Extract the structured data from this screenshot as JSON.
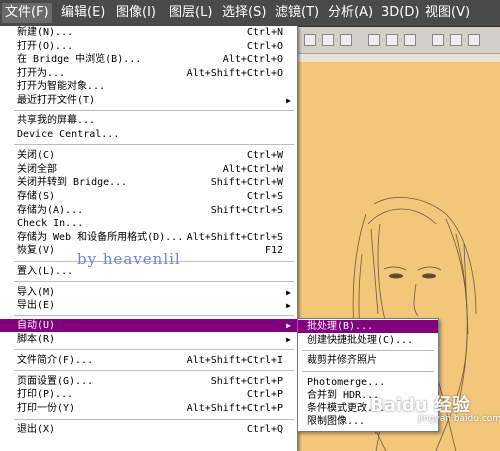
{
  "menubar": {
    "items": [
      {
        "label": "文件(F)"
      },
      {
        "label": "编辑(E)"
      },
      {
        "label": "图像(I)"
      },
      {
        "label": "图层(L)"
      },
      {
        "label": "选择(S)"
      },
      {
        "label": "滤镜(T)"
      },
      {
        "label": "分析(A)"
      },
      {
        "label": "3D(D)"
      },
      {
        "label": "视图(V)"
      }
    ]
  },
  "file_menu": {
    "items": [
      {
        "label": "新建(N)...",
        "shortcut": "Ctrl+N"
      },
      {
        "label": "打开(O)...",
        "shortcut": "Ctrl+O"
      },
      {
        "label": "在 Bridge 中浏览(B)...",
        "shortcut": "Alt+Ctrl+O"
      },
      {
        "label": "打开为...",
        "shortcut": "Alt+Shift+Ctrl+O"
      },
      {
        "label": "打开为智能对象...",
        "shortcut": ""
      },
      {
        "label": "最近打开文件(T)",
        "shortcut": ""
      },
      {
        "label": "共享我的屏幕...",
        "shortcut": ""
      },
      {
        "label": "Device Central...",
        "shortcut": ""
      },
      {
        "label": "关闭(C)",
        "shortcut": "Ctrl+W"
      },
      {
        "label": "关闭全部",
        "shortcut": "Alt+Ctrl+W"
      },
      {
        "label": "关闭并转到 Bridge...",
        "shortcut": "Shift+Ctrl+W"
      },
      {
        "label": "存储(S)",
        "shortcut": "Ctrl+S"
      },
      {
        "label": "存储为(A)...",
        "shortcut": "Shift+Ctrl+S"
      },
      {
        "label": "Check In...",
        "shortcut": ""
      },
      {
        "label": "存储为 Web 和设备所用格式(D)...",
        "shortcut": "Alt+Shift+Ctrl+S"
      },
      {
        "label": "恢复(V)",
        "shortcut": "F12"
      },
      {
        "label": "置入(L)...",
        "shortcut": ""
      },
      {
        "label": "导入(M)",
        "shortcut": ""
      },
      {
        "label": "导出(E)",
        "shortcut": ""
      },
      {
        "label": "自动(U)",
        "shortcut": ""
      },
      {
        "label": "脚本(R)",
        "shortcut": ""
      },
      {
        "label": "文件简介(F)...",
        "shortcut": "Alt+Shift+Ctrl+I"
      },
      {
        "label": "页面设置(G)...",
        "shortcut": "Shift+Ctrl+P"
      },
      {
        "label": "打印(P)...",
        "shortcut": "Ctrl+P"
      },
      {
        "label": "打印一份(Y)",
        "shortcut": "Alt+Shift+Ctrl+P"
      },
      {
        "label": "退出(X)",
        "shortcut": "Ctrl+Q"
      }
    ]
  },
  "automate_submenu": {
    "items": [
      {
        "label": "批处理(B)..."
      },
      {
        "label": "创建快捷批处理(C)..."
      },
      {
        "label": "裁剪并修齐照片"
      },
      {
        "label": "Photomerge..."
      },
      {
        "label": "合并到 HDR..."
      },
      {
        "label": "条件模式更改..."
      },
      {
        "label": "限制图像..."
      }
    ]
  },
  "watermark": "by heavenlil",
  "baidu": {
    "logo": "Baidu 经验",
    "sub": "jingyan.baidu.com"
  },
  "colors": {
    "highlight": "#800080",
    "canvas": "#f2c77a"
  }
}
